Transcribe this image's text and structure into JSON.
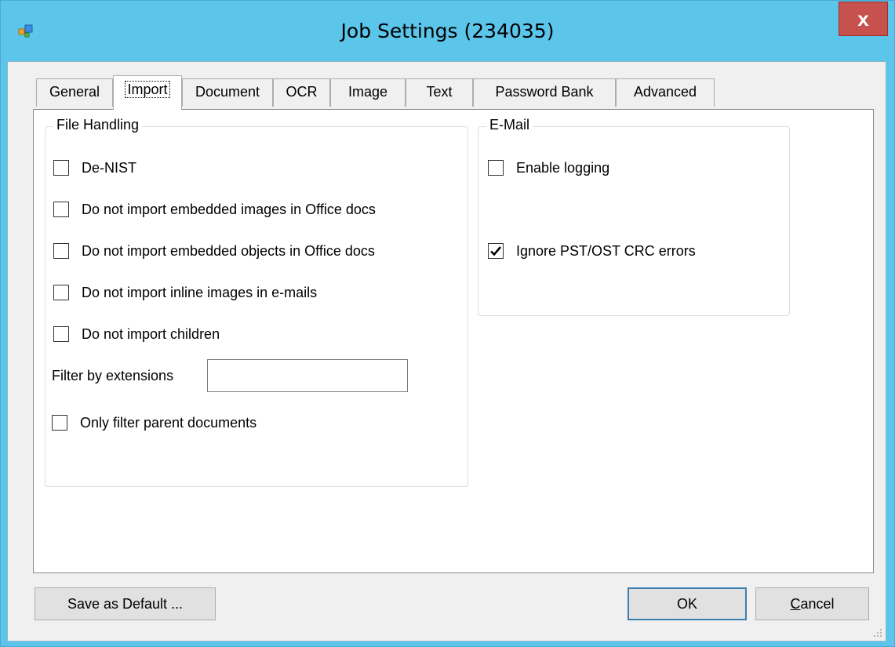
{
  "window": {
    "title": "Job Settings (234035)",
    "close_label": "x",
    "app_icon": "app-window-icon"
  },
  "tabs": [
    {
      "label": "General"
    },
    {
      "label": "Import",
      "selected": true
    },
    {
      "label": "Document"
    },
    {
      "label": "OCR"
    },
    {
      "label": "Image"
    },
    {
      "label": "Text"
    },
    {
      "label": "Password Bank"
    },
    {
      "label": "Advanced"
    }
  ],
  "file_handling": {
    "title": "File Handling",
    "options": [
      {
        "label": "De-NIST",
        "checked": false
      },
      {
        "label": "Do not import embedded images in Office docs",
        "checked": false
      },
      {
        "label": "Do not import embedded objects in Office docs",
        "checked": false
      },
      {
        "label": "Do not import inline images in e-mails",
        "checked": false
      },
      {
        "label": "Do not import children",
        "checked": false
      }
    ],
    "filter_label": "Filter by extensions",
    "filter_value": "",
    "only_filter_parent": {
      "label": "Only filter parent documents",
      "checked": false
    }
  },
  "email": {
    "title": "E-Mail",
    "options": [
      {
        "label": "Enable logging",
        "checked": false
      },
      {
        "label": "Ignore PST/OST CRC errors",
        "checked": true
      }
    ]
  },
  "buttons": {
    "save_default": "Save as Default ...",
    "ok": "OK",
    "cancel_prefix": "C",
    "cancel_rest": "ancel"
  }
}
